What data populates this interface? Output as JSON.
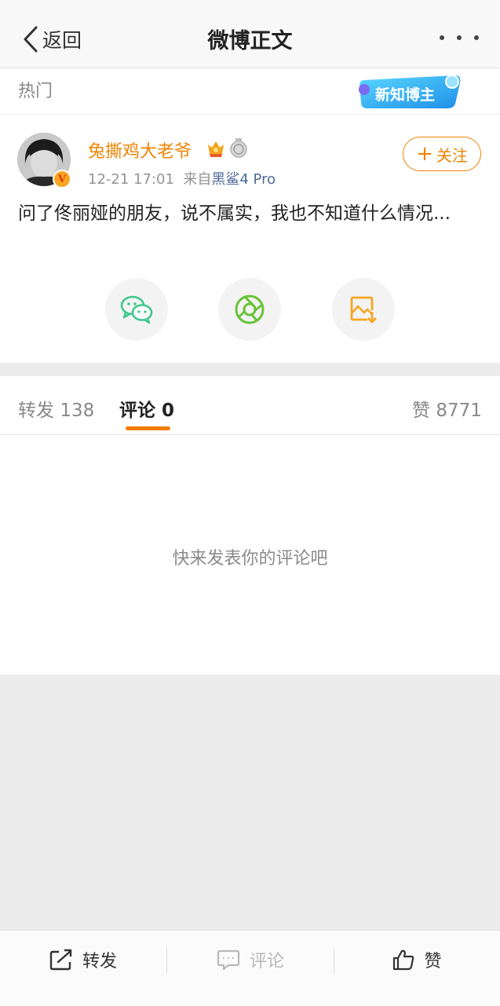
{
  "nav": {
    "back_label": "返回",
    "title": "微博正文"
  },
  "hot": {
    "label": "热门",
    "badge_text": "新知博主"
  },
  "post": {
    "username": "兔撕鸡大老爷",
    "time": "12-21 17:01",
    "source_prefix": "来自",
    "device": "黑鲨4 Pro",
    "follow_label": "关注",
    "text": "问了佟丽娅的朋友，说不属实，我也不知道什么情况..."
  },
  "tabs": {
    "repost_label": "转发",
    "repost_count": "138",
    "comment_label": "评论",
    "comment_count": "0",
    "like_label": "赞",
    "like_count": "8771"
  },
  "comments": {
    "empty_text": "快来发表你的评论吧"
  },
  "bottom_bar": {
    "repost": "转发",
    "comment": "评论",
    "like": "赞"
  },
  "colors": {
    "accent_orange": "#f08300",
    "device_link": "#4d6a96",
    "wechat_green": "#3cc78a",
    "moments_green": "#68c237",
    "save_orange": "#f6a623"
  }
}
